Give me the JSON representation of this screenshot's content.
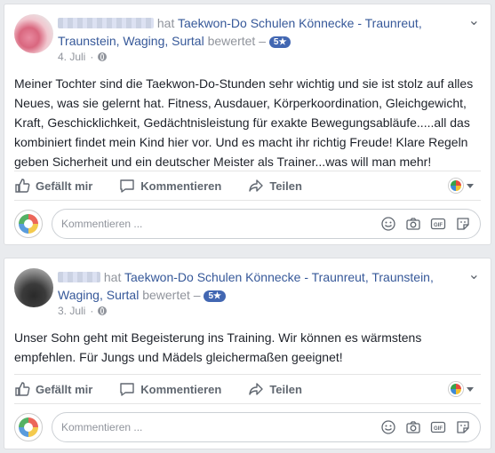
{
  "posts": [
    {
      "verb": "hat",
      "page": "Taekwon-Do Schulen Könnecke - Traunreut, Traunstein, Waging, Surtal",
      "rated": "bewertet –",
      "rating": "5",
      "date": "4. Juli",
      "text": "Meiner Tochter sind die Taekwon-Do-Stunden sehr wichtig und sie ist stolz auf alles Neues, was sie gelernt hat. Fitness, Ausdauer, Körperkoordination, Gleichgewicht, Kraft, Geschicklichkeit, Gedächtnisleistung für exakte Bewegungsabläufe.....all das kombiniert findet mein Kind hier vor. Und es macht ihr richtig Freude! Klare Regeln geben Sicherheit und ein deutscher Meister als Trainer...was will man mehr!"
    },
    {
      "verb": "hat",
      "page": "Taekwon-Do Schulen Könnecke - Traunreut, Traunstein, Waging, Surtal",
      "rated": "bewertet –",
      "rating": "5",
      "date": "3. Juli",
      "text": "Unser Sohn geht mit Begeisterung ins Training. Wir können es wärmstens empfehlen. Für Jungs und Mädels gleichermaßen geeignet!"
    }
  ],
  "actions": {
    "like": "Gefällt mir",
    "comment": "Kommentieren",
    "share": "Teilen"
  },
  "comment_placeholder": "Kommentieren ...",
  "menu_icon": "chevron-down-icon",
  "colors": {
    "link": "#365899",
    "badge": "#4267b2",
    "muted": "#90949c",
    "action": "#606770"
  }
}
